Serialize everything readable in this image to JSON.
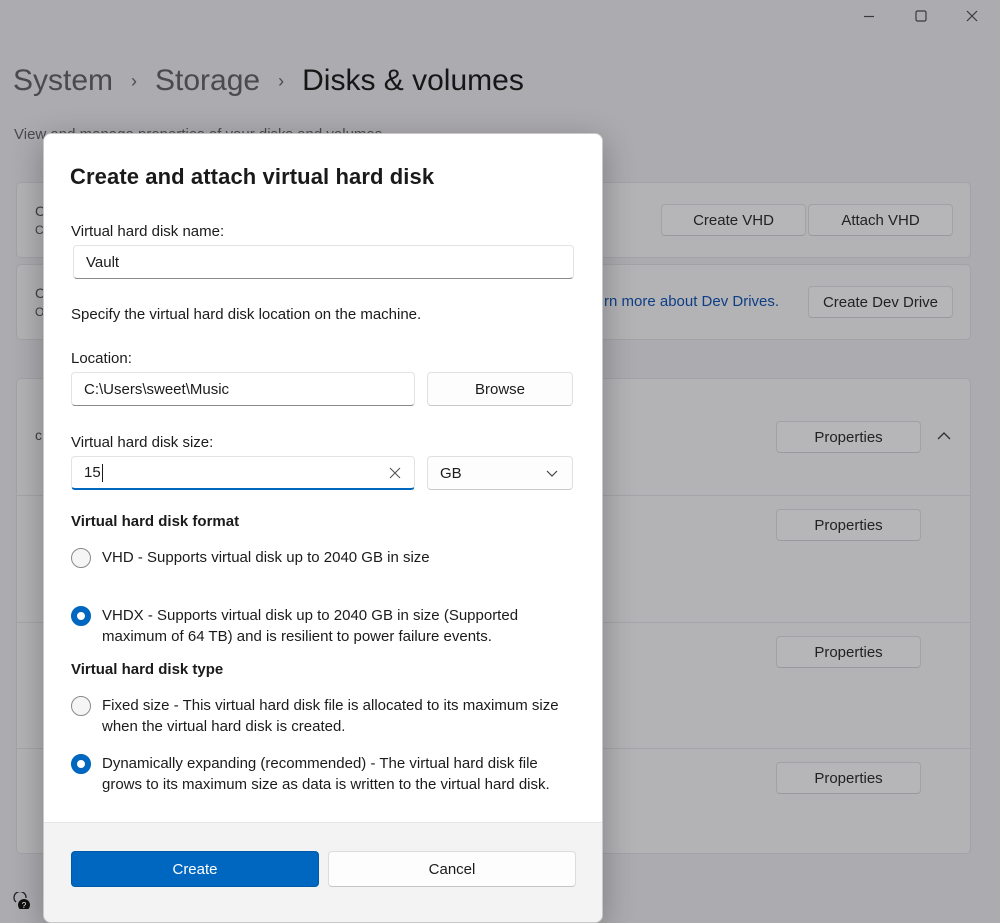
{
  "window": {
    "controls": {
      "minimize": "minimize",
      "maximize": "maximize",
      "close": "close"
    }
  },
  "breadcrumb": {
    "items": [
      "System",
      "Storage",
      "Disks & volumes"
    ],
    "separator": "›"
  },
  "page": {
    "subtitle": "View and manage properties of your disks and volumes"
  },
  "background": {
    "card1": {
      "letter1": "C",
      "letter2": "C",
      "buttons": [
        "Create VHD",
        "Attach VHD"
      ]
    },
    "card2": {
      "letter1": "C",
      "letter2": "O",
      "link": "rn more about Dev Drives.",
      "button": "Create Dev Drive"
    },
    "card3": {
      "letter": "c",
      "properties_label": "Properties"
    }
  },
  "dialog": {
    "title": "Create and attach virtual hard disk",
    "name_label": "Virtual hard disk name:",
    "name_value": "Vault",
    "location_hint": "Specify the virtual hard disk location on the machine.",
    "location_label": "Location:",
    "location_value": "C:\\Users\\sweet\\Music",
    "browse_label": "Browse",
    "size_label": "Virtual hard disk size:",
    "size_value": "15",
    "size_unit": "GB",
    "format_heading": "Virtual hard disk format",
    "format_options": [
      {
        "label": "VHD - Supports virtual disk up to 2040 GB in size",
        "checked": false
      },
      {
        "label": "VHDX - Supports virtual disk up to 2040 GB in size (Supported maximum of 64 TB) and is resilient to power failure events.",
        "checked": true
      }
    ],
    "type_heading": "Virtual hard disk type",
    "type_options": [
      {
        "label": "Fixed size - This virtual hard disk file is allocated to its maximum size when the virtual hard disk is created.",
        "checked": false
      },
      {
        "label": "Dynamically expanding (recommended) - The virtual hard disk file grows to its maximum size as data is written to the virtual hard disk.",
        "checked": true
      }
    ],
    "create_label": "Create",
    "cancel_label": "Cancel"
  },
  "colors": {
    "accent": "#0067c0",
    "link": "#0e3f86",
    "overlay_bg": "#acabaf"
  }
}
